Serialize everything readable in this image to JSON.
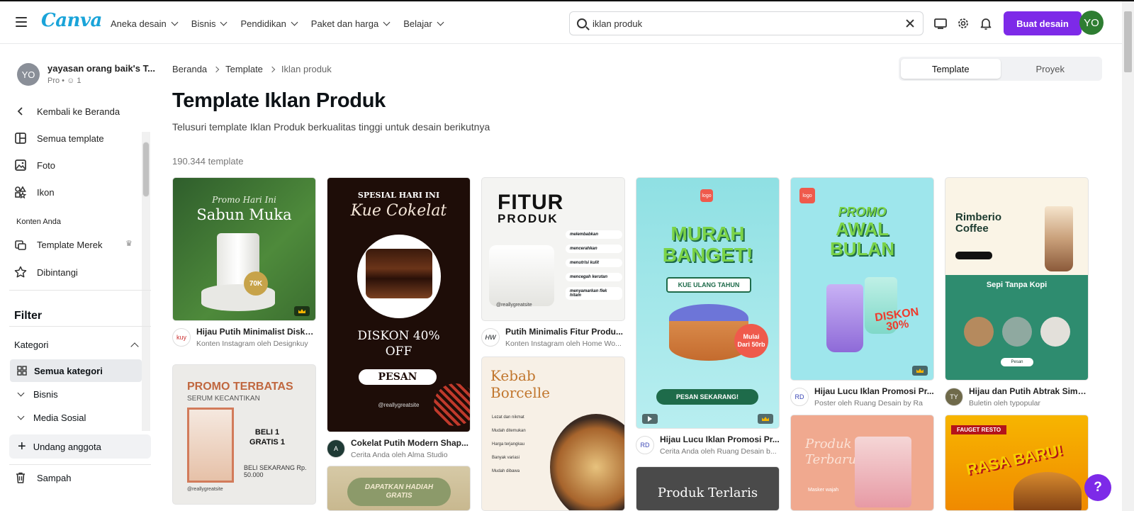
{
  "header": {
    "logo": "Canva",
    "nav": [
      "Aneka desain",
      "Bisnis",
      "Pendidikan",
      "Paket dan harga",
      "Belajar"
    ],
    "search_value": "iklan produk",
    "create_label": "Buat desain",
    "user_initials": "YO"
  },
  "sidebar": {
    "team_initials": "YO",
    "team_name": "yayasan orang baik's T...",
    "team_plan": "Pro",
    "team_members": "1",
    "back_label": "Kembali ke Beranda",
    "links": [
      "Semua template",
      "Foto",
      "Ikon"
    ],
    "content_section": "Konten Anda",
    "brand_templates": "Template Merek",
    "starred": "Dibintangi",
    "filter_title": "Filter",
    "category_label": "Kategori",
    "categories": [
      "Semua kategori",
      "Bisnis",
      "Media Sosial"
    ],
    "invite_label": "Undang anggota",
    "trash_label": "Sampah"
  },
  "main": {
    "breadcrumb": [
      "Beranda",
      "Template",
      "Iklan produk"
    ],
    "toggle": [
      "Template",
      "Proyek"
    ],
    "title": "Template Iklan Produk",
    "subtitle": "Telusuri template Iklan Produk berkualitas tinggi untuk desain berikutnya",
    "count": "190.344 template",
    "cards": [
      {
        "title": "Hijau Putih Minimalist Disko...",
        "by": "Konten Instagram oleh Designkuy",
        "poster_a": "Promo Hari Ini",
        "poster_b": "Sabun Muka",
        "poster_c": "70K",
        "avatar": "kuy"
      },
      {
        "title": "Cokelat Putih Modern Shap...",
        "by": "Cerita Anda oleh Alma Studio",
        "poster_a": "SPESIAL HARI INI",
        "poster_b": "Kue Cokelat",
        "poster_c": "DISKON 40% OFF",
        "poster_d": "PESAN",
        "poster_e": "@reallygreatsite",
        "avatar": "A"
      },
      {
        "title": "Putih Minimalis Fitur Produ...",
        "by": "Konten Instagram oleh Home Wo...",
        "poster_a": "FITUR",
        "poster_b": "PRODUK",
        "poster_e": "@reallygreatsite",
        "features": [
          "melembabkan",
          "mencerahkan",
          "menutrisi kulit",
          "mencegah kerutan",
          "menyamarkan flek hitam"
        ],
        "avatar": "HW"
      },
      {
        "title": "Hijau Lucu Iklan Promosi Pr...",
        "by": "Cerita Anda oleh Ruang Desain b...",
        "poster_a": "MURAH BANGET!",
        "poster_b": "KUE ULANG TAHUN",
        "poster_c": "Mulai Dari 50rb",
        "poster_d": "PESAN SEKARANG!",
        "avatar": "RD"
      },
      {
        "title": "Hijau Lucu Iklan Promosi Pr...",
        "by": "Poster oleh Ruang Desain by Ra",
        "poster_a": "PROMO",
        "poster_b": "AWAL BULAN",
        "poster_c": "DISKON 30%",
        "avatar": "RD"
      },
      {
        "title": "Hijau dan Putih Abtrak Simp...",
        "by": "Buletin oleh typopular",
        "poster_a": "Rimberio Coffee",
        "poster_b": "Sepi Tanpa Kopi",
        "poster_c": "Pesan",
        "avatar": "TY"
      },
      {
        "poster_a": "PROMO TERBATAS",
        "poster_b": "SERUM KECANTIKAN",
        "poster_c": "BELI 1 GRATIS 1",
        "poster_d": "BELI SEKARANG Rp. 50.000",
        "poster_e": "@reallygreatsite"
      },
      {
        "poster_a": "DAPATKAN HADIAH GRATIS"
      },
      {
        "poster_a": "Kebab Borcelle",
        "features": [
          "Lezat dan nikmat",
          "Mudah ditemukan",
          "Harga terjangkau",
          "Banyak variasi",
          "Mudah dibawa"
        ]
      },
      {
        "poster_a": "Produk Terlaris"
      },
      {
        "poster_a": "Produk Terbaru",
        "features": [
          "Masker wajah"
        ]
      },
      {
        "poster_a": "FAUGET RESTO",
        "poster_b": "RASA BARU!"
      }
    ]
  },
  "help_label": "?",
  "colors": {
    "brand": "#7d2ae8",
    "logo": "#1aa4d9",
    "avatar": "#2e7d32"
  }
}
